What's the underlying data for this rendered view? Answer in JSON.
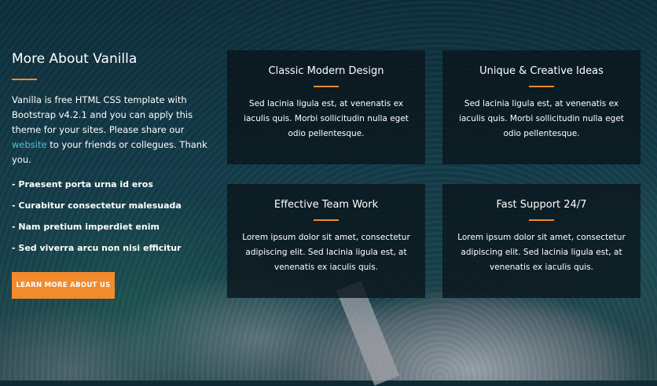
{
  "about": {
    "title": "More About Vanilla",
    "text_before_link": "Vanilla is free HTML CSS template with Bootstrap v4.2.1 and you can apply this theme for your sites. Please share our ",
    "link_text": "website",
    "text_after_link": " to your friends or collegues. Thank you.",
    "list": [
      "- Praesent porta urna id eros",
      "- Curabitur consectetur malesuada",
      "- Nam pretium imperdiet enim",
      "- Sed viverra arcu non nisi efficitur"
    ],
    "button_label": "LEARN MORE ABOUT US"
  },
  "features": [
    {
      "title": "Classic Modern Design",
      "text": "Sed lacinia ligula est, at venenatis ex iaculis quis. Morbi sollicitudin nulla eget odio pellentesque."
    },
    {
      "title": "Unique & Creative Ideas",
      "text": "Sed lacinia ligula est, at venenatis ex iaculis quis. Morbi sollicitudin nulla eget odio pellentesque."
    },
    {
      "title": "Effective Team Work",
      "text": "Lorem ipsum dolor sit amet, consectetur adipiscing elit. Sed lacinia ligula est, at venenatis ex iaculis quis."
    },
    {
      "title": "Fast Support 24/7",
      "text": "Lorem ipsum dolor sit amet, consectetur adipiscing elit. Sed lacinia ligula est, at venenatis ex iaculis quis."
    }
  ],
  "colors": {
    "accent": "#f28a2e",
    "link": "#4fc2d6",
    "card_bg": "#0b161c"
  }
}
